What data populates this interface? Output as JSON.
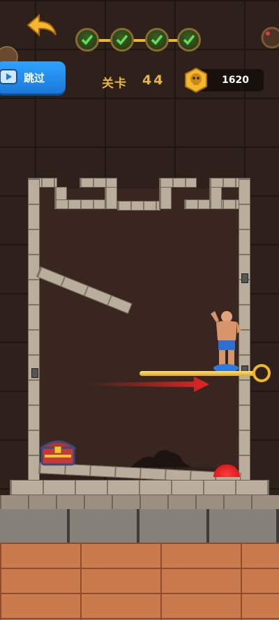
{
  "hud": {
    "back_button_icon": "back-arrow-icon",
    "level_label": "关卡",
    "level_number": "44",
    "coins": "1620",
    "skip_label": "跳过",
    "progress_checks": 4,
    "accent_color": "#f0b52a"
  },
  "scene": {
    "hero_icon": "hero-character",
    "pin_icon": "pull-pin",
    "chest_icon": "treasure-chest",
    "hint_arrow_color": "#e62424"
  }
}
